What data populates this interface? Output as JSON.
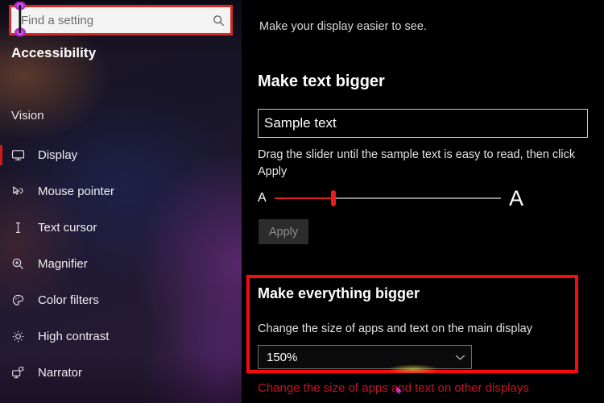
{
  "sidebar": {
    "search": {
      "placeholder": "Find a setting",
      "value": "",
      "icon": "search-icon"
    },
    "title": "Accessibility",
    "group_label": "Vision",
    "items": [
      {
        "label": "Display",
        "icon": "monitor-icon",
        "selected": true
      },
      {
        "label": "Mouse pointer",
        "icon": "mouse-pointer-icon",
        "selected": false
      },
      {
        "label": "Text cursor",
        "icon": "text-cursor-icon",
        "selected": false
      },
      {
        "label": "Magnifier",
        "icon": "magnifier-icon",
        "selected": false
      },
      {
        "label": "Color filters",
        "icon": "color-palette-icon",
        "selected": false
      },
      {
        "label": "High contrast",
        "icon": "brightness-icon",
        "selected": false
      },
      {
        "label": "Narrator",
        "icon": "narrator-icon",
        "selected": false
      }
    ]
  },
  "main": {
    "lede": "Make your display easier to see.",
    "make_text_bigger": {
      "heading": "Make text bigger",
      "sample_text": "Sample text",
      "hint": "Drag the slider until the sample text is easy to read, then click Apply",
      "slider": {
        "min_label": "A",
        "max_label": "A",
        "value_percent": 26
      },
      "apply_label": "Apply"
    },
    "make_everything_bigger": {
      "heading": "Make everything bigger",
      "sub_label": "Change the size of apps and text on the main display",
      "scale_value": "150%",
      "chevron_icon": "chevron-down-icon",
      "other_displays_link": "Change the size of apps and text on other displays"
    }
  },
  "colors": {
    "highlight_border": "#fa0a0a",
    "search_border": "#d52b28",
    "accent_red": "#d11b1b",
    "slider_red": "#ea1c1c",
    "link_red": "#c3132a",
    "cursor_magenta": "#b42ad0"
  }
}
